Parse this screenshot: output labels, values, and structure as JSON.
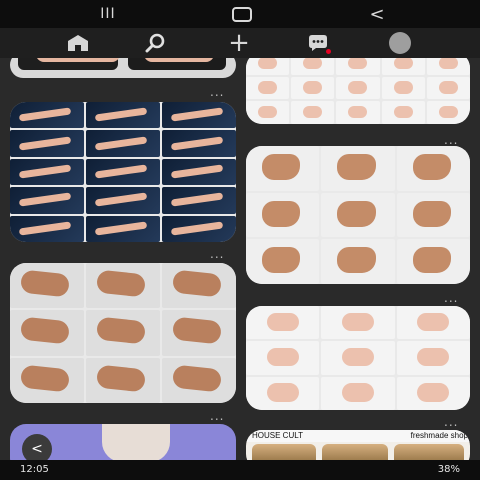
{
  "system_nav": {
    "recents_icon": "recents-icon",
    "home_icon": "home-circle-icon",
    "back_icon": "back-chevron-icon",
    "recents_glyph": "III",
    "back_glyph": "<"
  },
  "app_nav": {
    "items": [
      {
        "name": "home",
        "icon": "home-icon"
      },
      {
        "name": "search",
        "icon": "search-icon"
      },
      {
        "name": "create",
        "icon": "plus-icon",
        "glyph": "+"
      },
      {
        "name": "messages",
        "icon": "chat-icon"
      },
      {
        "name": "profile",
        "icon": "avatar-icon"
      }
    ],
    "accent": "#e60023"
  },
  "pins": {
    "more_glyph": "...",
    "back_button_glyph": "<",
    "brand_left": "HOUSE CULT",
    "brand_right": "freshmade shop",
    "colors": {
      "feed_bg": "#2a2a2a",
      "card_bg": "#e9e9e9",
      "blue_card_bg": "#8a86d8"
    }
  },
  "status_bar": {
    "time": "12:05",
    "right": "38%"
  }
}
